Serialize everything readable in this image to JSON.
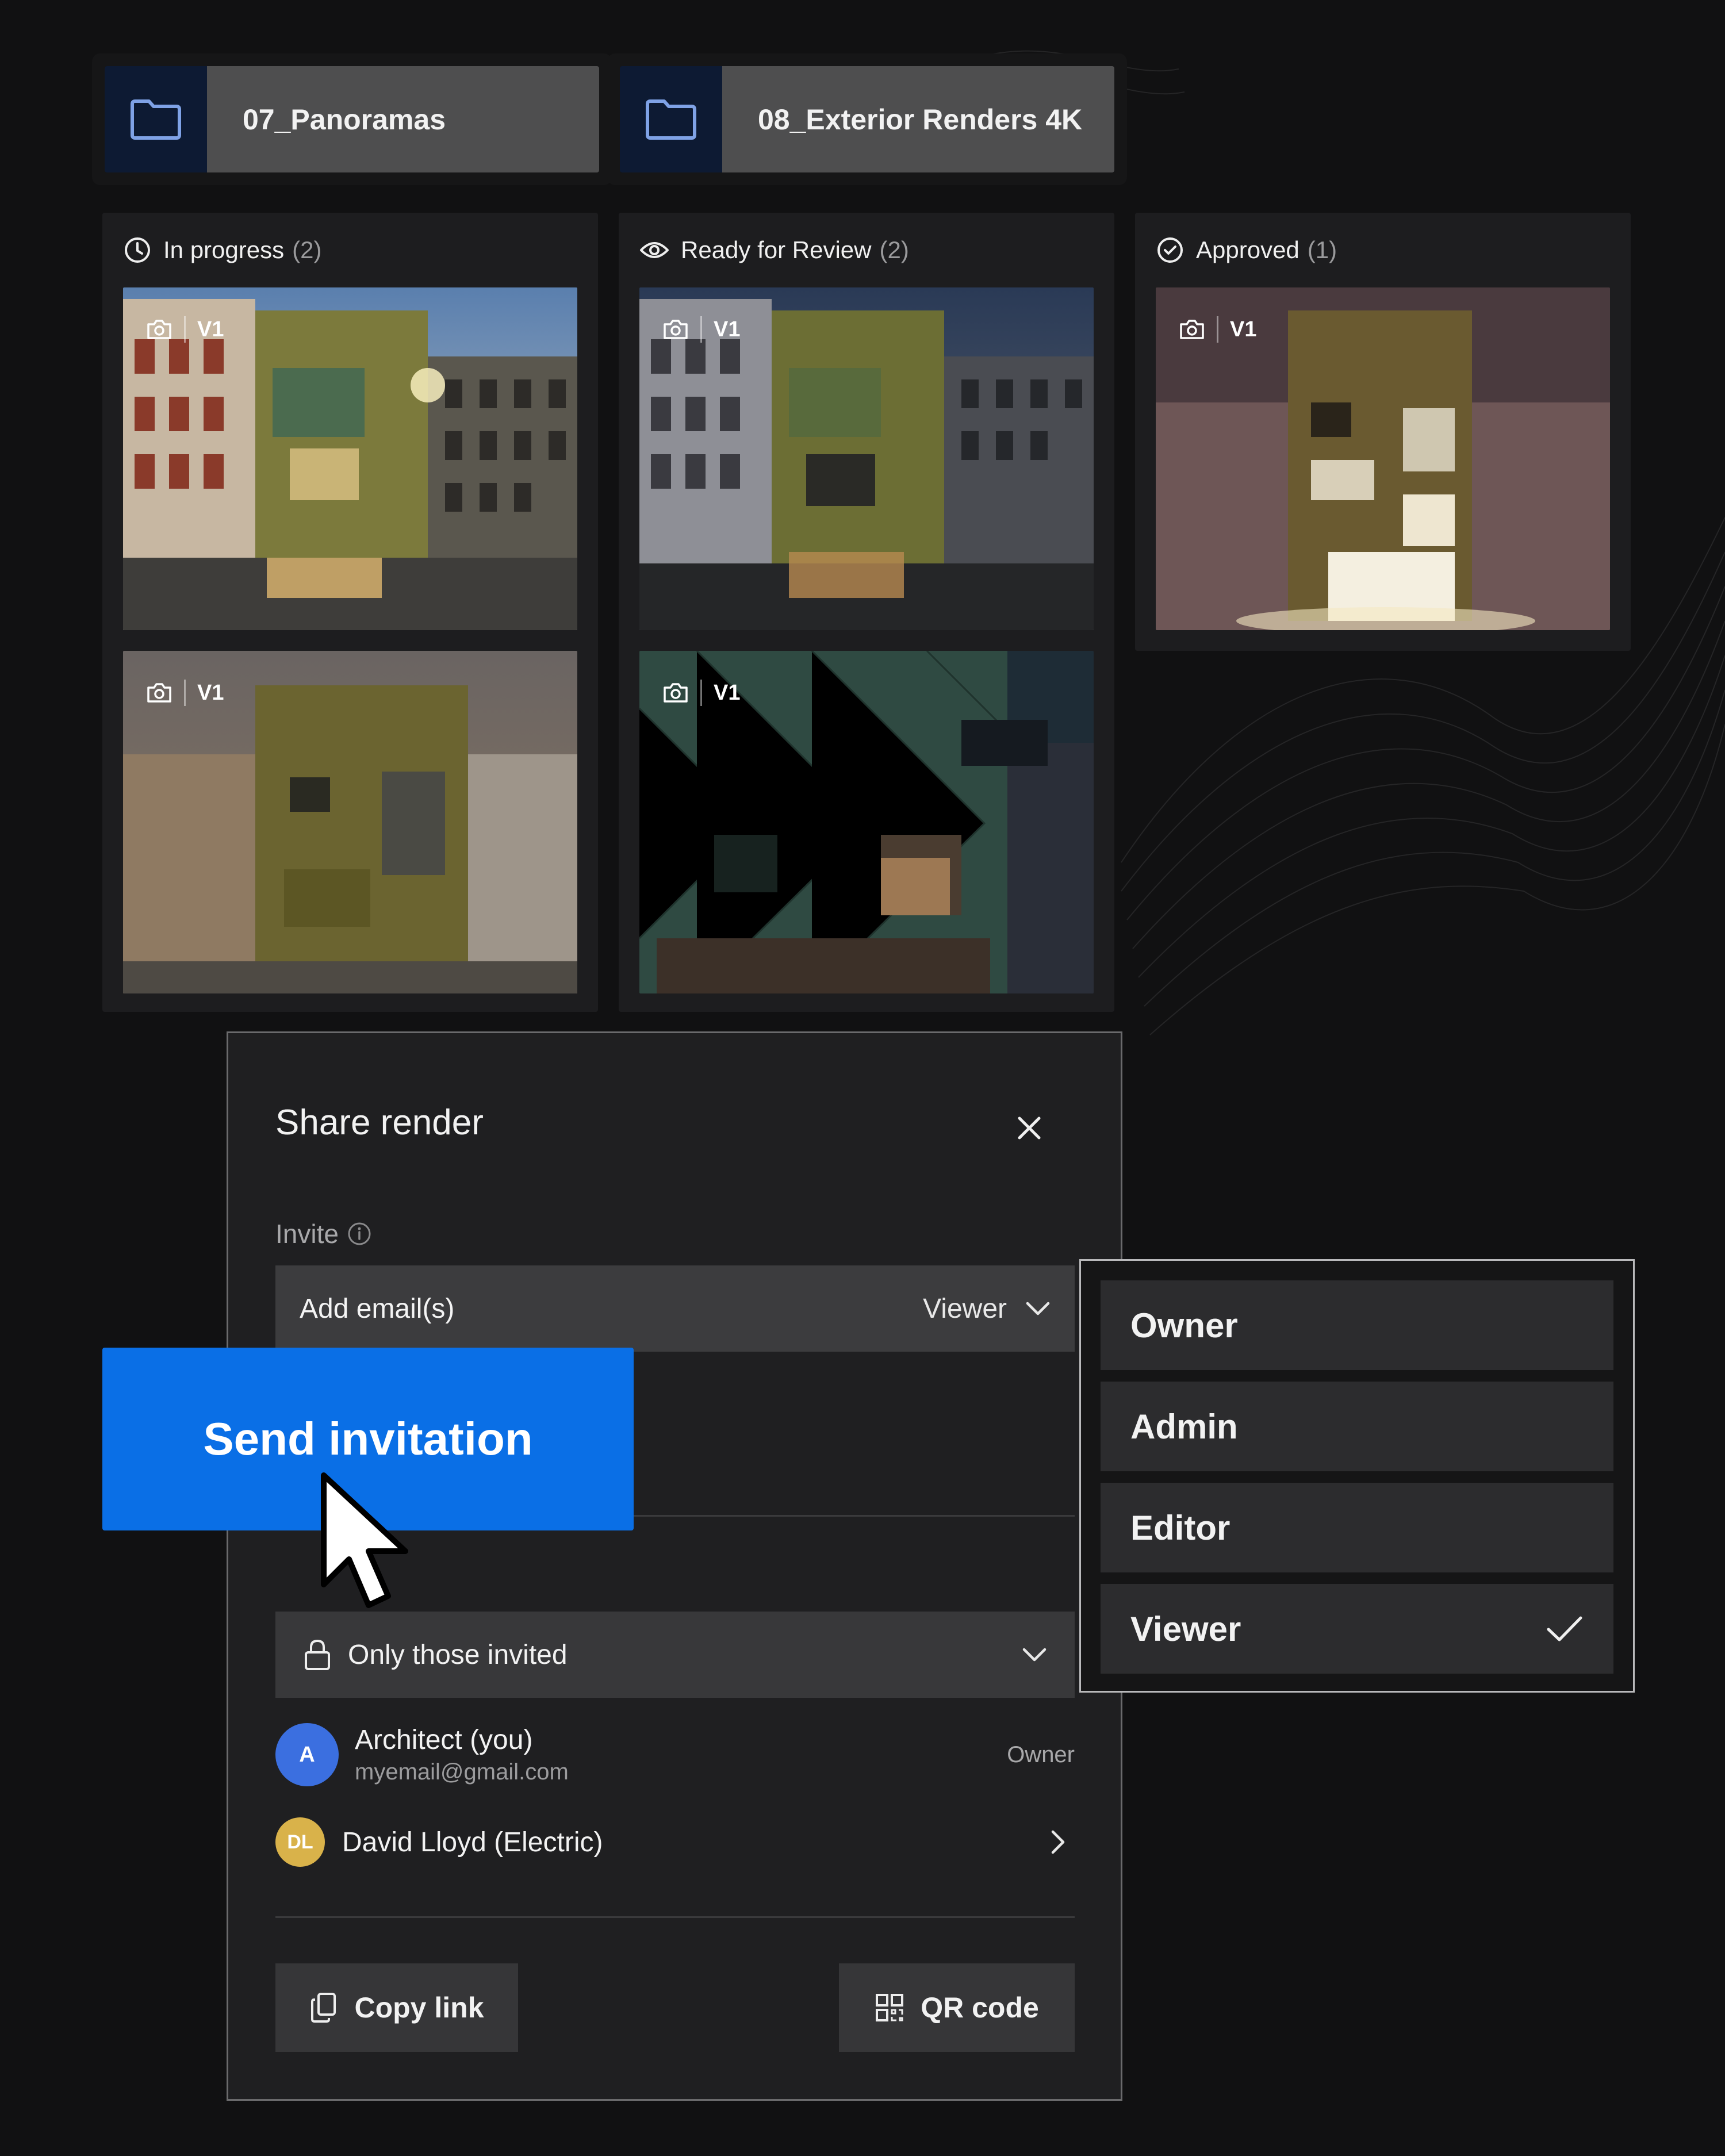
{
  "folders": [
    {
      "name": "07_Panoramas",
      "icon": "folder-icon"
    },
    {
      "name": "08_Exterior Renders 4K",
      "icon": "folder-icon"
    }
  ],
  "columns": [
    {
      "title": "In progress",
      "count": "(2)",
      "icon": "clock-icon",
      "renders": [
        {
          "version": "V1",
          "icon": "camera-icon"
        },
        {
          "version": "V1",
          "icon": "camera-icon"
        }
      ]
    },
    {
      "title": "Ready for Review",
      "count": "(2)",
      "icon": "eye-icon",
      "renders": [
        {
          "version": "V1",
          "icon": "camera-icon"
        },
        {
          "version": "V1",
          "icon": "camera-icon"
        }
      ]
    },
    {
      "title": "Approved",
      "count": "(1)",
      "icon": "check-circle-icon",
      "renders": [
        {
          "version": "V1",
          "icon": "camera-icon"
        }
      ]
    }
  ],
  "share_dialog": {
    "title": "Share render",
    "invite_label": "Invite",
    "email_placeholder": "Add email(s)",
    "selected_role": "Viewer",
    "access_option": "Only those invited",
    "people": [
      {
        "initials": "A",
        "name": "Architect (you)",
        "email": "myemail@gmail.com",
        "role": "Owner",
        "avatar_color": "#3b6fe0"
      },
      {
        "initials": "DL",
        "name": "David Lloyd (Electric)",
        "avatar_color": "#d9b24a"
      }
    ],
    "copy_link_label": "Copy link",
    "qr_label": "QR code"
  },
  "send_button_label": "Send invitation",
  "role_menu": {
    "options": [
      "Owner",
      "Admin",
      "Editor",
      "Viewer"
    ],
    "selected": "Viewer"
  },
  "colors": {
    "accent": "#0a6fe6",
    "background": "#111112",
    "panel": "#1d1d1f"
  }
}
